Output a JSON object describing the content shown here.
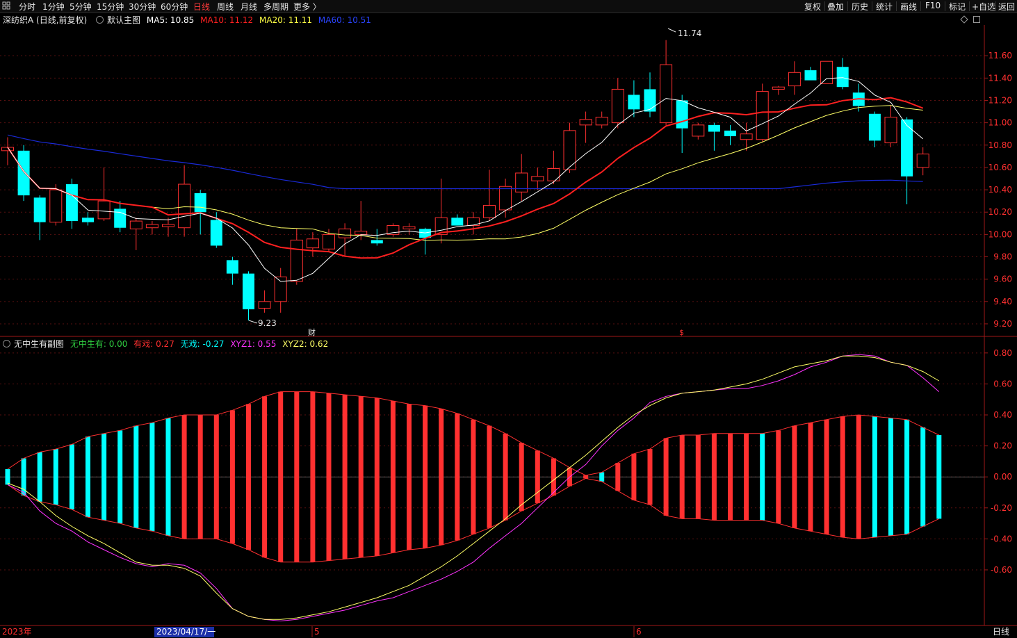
{
  "toolbar": {
    "left_icon": "grid-icon",
    "tabs": [
      "分时",
      "1分钟",
      "5分钟",
      "15分钟",
      "30分钟",
      "60分钟",
      "日线",
      "周线",
      "月线",
      "多周期",
      "更多 〉"
    ],
    "active_tab": "日线",
    "right_buttons": [
      "复权",
      "叠加",
      "历史",
      "统计",
      "画线",
      "F10",
      "标记",
      "+自选",
      "返回"
    ]
  },
  "main_info": {
    "stock": "深纺织A (日线,前复权)",
    "indicator": "默认主图",
    "ma5": "MA5: 10.85",
    "ma10": "MA10: 11.12",
    "ma20": "MA20: 11.11",
    "ma60": "MA60: 10.51"
  },
  "sub_info": {
    "indicator": "无中生有副图",
    "v1": "无中生有: 0.00",
    "v2": "有戏: 0.27",
    "v3": "无戏: -0.27",
    "v4": "XYZ1: 0.55",
    "v5": "XYZ2: 0.62"
  },
  "date_axis": {
    "start": "2023年",
    "cursor": "2023/04/17/一",
    "m5": "5",
    "m6": "6"
  },
  "period_label": "日线",
  "markers": {
    "high": "11.74",
    "low": "9.23",
    "cai": "财",
    "dollar": "$"
  },
  "colors": {
    "up": "#ff3030",
    "down": "#00ffff",
    "ma5": "#ffffff",
    "ma10": "#ff2020",
    "ma20": "#ffff66",
    "ma60": "#1a2ad8",
    "xyz1": "#ff33ff",
    "xyz2": "#ffff66"
  },
  "chart_data": [
    {
      "type": "candlestick",
      "title": "深纺织A (日线,前复权)",
      "ylim": [
        9.15,
        11.85
      ],
      "yticks": [
        9.2,
        9.4,
        9.6,
        9.8,
        10.0,
        10.2,
        10.4,
        10.6,
        10.8,
        11.0,
        11.2,
        11.4,
        11.6
      ],
      "candles": [
        {
          "o": 10.75,
          "h": 10.87,
          "l": 10.62,
          "c": 10.78
        },
        {
          "o": 10.75,
          "h": 10.8,
          "l": 10.3,
          "c": 10.35
        },
        {
          "o": 10.33,
          "h": 10.35,
          "l": 9.95,
          "c": 10.11
        },
        {
          "o": 10.11,
          "h": 10.45,
          "l": 10.08,
          "c": 10.4
        },
        {
          "o": 10.45,
          "h": 10.5,
          "l": 10.05,
          "c": 10.12
        },
        {
          "o": 10.15,
          "h": 10.2,
          "l": 10.08,
          "c": 10.11
        },
        {
          "o": 10.14,
          "h": 10.6,
          "l": 10.12,
          "c": 10.3
        },
        {
          "o": 10.23,
          "h": 10.3,
          "l": 10.02,
          "c": 10.06
        },
        {
          "o": 10.05,
          "h": 10.15,
          "l": 9.86,
          "c": 10.12
        },
        {
          "o": 10.06,
          "h": 10.12,
          "l": 10.0,
          "c": 10.09
        },
        {
          "o": 10.07,
          "h": 10.15,
          "l": 9.98,
          "c": 10.09
        },
        {
          "o": 10.06,
          "h": 10.62,
          "l": 9.98,
          "c": 10.45
        },
        {
          "o": 10.37,
          "h": 10.4,
          "l": 10.0,
          "c": 10.2
        },
        {
          "o": 10.13,
          "h": 10.2,
          "l": 9.88,
          "c": 9.9
        },
        {
          "o": 9.77,
          "h": 9.8,
          "l": 9.55,
          "c": 9.65
        },
        {
          "o": 9.65,
          "h": 9.67,
          "l": 9.23,
          "c": 9.33
        },
        {
          "o": 9.34,
          "h": 9.5,
          "l": 9.3,
          "c": 9.4
        },
        {
          "o": 9.4,
          "h": 9.7,
          "l": 9.3,
          "c": 9.62
        },
        {
          "o": 9.58,
          "h": 10.05,
          "l": 9.55,
          "c": 9.95
        },
        {
          "o": 9.88,
          "h": 10.02,
          "l": 9.8,
          "c": 9.96
        },
        {
          "o": 9.87,
          "h": 10.05,
          "l": 9.85,
          "c": 10.0
        },
        {
          "o": 9.97,
          "h": 10.1,
          "l": 9.8,
          "c": 10.05
        },
        {
          "o": 10.0,
          "h": 10.3,
          "l": 9.95,
          "c": 10.03
        },
        {
          "o": 9.95,
          "h": 10.05,
          "l": 9.9,
          "c": 9.92
        },
        {
          "o": 10.0,
          "h": 10.1,
          "l": 9.98,
          "c": 10.08
        },
        {
          "o": 10.05,
          "h": 10.1,
          "l": 10.0,
          "c": 10.07
        },
        {
          "o": 10.05,
          "h": 10.06,
          "l": 9.82,
          "c": 9.97
        },
        {
          "o": 10.0,
          "h": 10.5,
          "l": 9.92,
          "c": 10.15
        },
        {
          "o": 10.15,
          "h": 10.18,
          "l": 10.08,
          "c": 10.08
        },
        {
          "o": 10.08,
          "h": 10.2,
          "l": 10.0,
          "c": 10.15
        },
        {
          "o": 10.15,
          "h": 10.58,
          "l": 10.12,
          "c": 10.26
        },
        {
          "o": 10.22,
          "h": 10.5,
          "l": 10.15,
          "c": 10.43
        },
        {
          "o": 10.38,
          "h": 10.72,
          "l": 10.3,
          "c": 10.55
        },
        {
          "o": 10.48,
          "h": 10.6,
          "l": 10.4,
          "c": 10.52
        },
        {
          "o": 10.48,
          "h": 10.75,
          "l": 10.45,
          "c": 10.59
        },
        {
          "o": 10.58,
          "h": 11.0,
          "l": 10.55,
          "c": 10.93
        },
        {
          "o": 10.98,
          "h": 11.1,
          "l": 10.82,
          "c": 11.03
        },
        {
          "o": 10.98,
          "h": 11.1,
          "l": 10.95,
          "c": 11.05
        },
        {
          "o": 11.0,
          "h": 11.4,
          "l": 10.95,
          "c": 11.3
        },
        {
          "o": 11.25,
          "h": 11.38,
          "l": 11.05,
          "c": 11.12
        },
        {
          "o": 11.3,
          "h": 11.45,
          "l": 11.05,
          "c": 11.1
        },
        {
          "o": 11.0,
          "h": 11.74,
          "l": 10.98,
          "c": 11.52
        },
        {
          "o": 11.2,
          "h": 11.25,
          "l": 10.73,
          "c": 10.95
        },
        {
          "o": 10.88,
          "h": 11.0,
          "l": 10.85,
          "c": 10.98
        },
        {
          "o": 10.98,
          "h": 11.0,
          "l": 10.75,
          "c": 10.92
        },
        {
          "o": 10.93,
          "h": 10.98,
          "l": 10.8,
          "c": 10.88
        },
        {
          "o": 10.85,
          "h": 11.0,
          "l": 10.75,
          "c": 10.9
        },
        {
          "o": 10.85,
          "h": 11.35,
          "l": 10.83,
          "c": 11.28
        },
        {
          "o": 11.3,
          "h": 11.33,
          "l": 11.25,
          "c": 11.32
        },
        {
          "o": 11.33,
          "h": 11.55,
          "l": 11.25,
          "c": 11.45
        },
        {
          "o": 11.47,
          "h": 11.5,
          "l": 11.38,
          "c": 11.38
        },
        {
          "o": 11.35,
          "h": 11.55,
          "l": 11.35,
          "c": 11.55
        },
        {
          "o": 11.5,
          "h": 11.58,
          "l": 11.3,
          "c": 11.32
        },
        {
          "o": 11.27,
          "h": 11.35,
          "l": 11.1,
          "c": 11.15
        },
        {
          "o": 11.08,
          "h": 11.1,
          "l": 10.78,
          "c": 10.84
        },
        {
          "o": 10.82,
          "h": 11.15,
          "l": 10.78,
          "c": 11.05
        },
        {
          "o": 11.03,
          "h": 11.05,
          "l": 10.27,
          "c": 10.52
        },
        {
          "o": 10.6,
          "h": 10.78,
          "l": 10.53,
          "c": 10.72
        }
      ]
    },
    {
      "type": "bar",
      "title": "无中生有副图",
      "ylim": [
        -0.95,
        0.88
      ],
      "yticks": [
        -0.6,
        -0.4,
        -0.2,
        0.0,
        0.2,
        0.4,
        0.6,
        0.8
      ],
      "series": [
        {
          "name": "有戏",
          "values": [
            0.05,
            0.12,
            0.16,
            0.18,
            0.21,
            0.26,
            0.28,
            0.3,
            0.33,
            0.35,
            0.38,
            0.4,
            0.4,
            0.4,
            0.43,
            0.47,
            0.52,
            0.55,
            0.55,
            0.55,
            0.54,
            0.53,
            0.52,
            0.51,
            0.49,
            0.47,
            0.46,
            0.44,
            0.41,
            0.37,
            0.33,
            0.28,
            0.22,
            0.17,
            0.12,
            0.06,
            0.01,
            0.03,
            0.09,
            0.15,
            0.18,
            0.25,
            0.27,
            0.27,
            0.28,
            0.28,
            0.28,
            0.28,
            0.3,
            0.33,
            0.35,
            0.37,
            0.39,
            0.4,
            0.39,
            0.38,
            0.37,
            0.32,
            0.27
          ]
        },
        {
          "name": "无戏",
          "values": [
            -0.05,
            -0.12,
            -0.16,
            -0.18,
            -0.21,
            -0.26,
            -0.28,
            -0.3,
            -0.33,
            -0.35,
            -0.38,
            -0.4,
            -0.4,
            -0.4,
            -0.43,
            -0.47,
            -0.52,
            -0.55,
            -0.55,
            -0.55,
            -0.54,
            -0.53,
            -0.52,
            -0.51,
            -0.49,
            -0.47,
            -0.46,
            -0.44,
            -0.41,
            -0.37,
            -0.33,
            -0.28,
            -0.22,
            -0.17,
            -0.12,
            -0.06,
            -0.01,
            -0.03,
            -0.09,
            -0.15,
            -0.18,
            -0.25,
            -0.27,
            -0.27,
            -0.28,
            -0.28,
            -0.28,
            -0.28,
            -0.3,
            -0.33,
            -0.35,
            -0.37,
            -0.39,
            -0.4,
            -0.39,
            -0.38,
            -0.37,
            -0.32,
            -0.27
          ]
        },
        {
          "name": "XYZ1",
          "values": [
            -0.05,
            -0.1,
            -0.22,
            -0.3,
            -0.35,
            -0.42,
            -0.47,
            -0.52,
            -0.56,
            -0.58,
            -0.56,
            -0.57,
            -0.62,
            -0.72,
            -0.85,
            -0.9,
            -0.92,
            -0.93,
            -0.92,
            -0.9,
            -0.88,
            -0.86,
            -0.83,
            -0.8,
            -0.78,
            -0.74,
            -0.7,
            -0.66,
            -0.61,
            -0.55,
            -0.46,
            -0.38,
            -0.3,
            -0.2,
            -0.1,
            0.0,
            0.08,
            0.2,
            0.3,
            0.38,
            0.48,
            0.52,
            0.54,
            0.55,
            0.56,
            0.57,
            0.57,
            0.59,
            0.62,
            0.66,
            0.71,
            0.74,
            0.78,
            0.79,
            0.78,
            0.74,
            0.72,
            0.64,
            0.55
          ]
        },
        {
          "name": "XYZ2",
          "values": [
            -0.04,
            -0.08,
            -0.16,
            -0.25,
            -0.32,
            -0.38,
            -0.43,
            -0.49,
            -0.55,
            -0.57,
            -0.57,
            -0.59,
            -0.64,
            -0.75,
            -0.85,
            -0.9,
            -0.92,
            -0.92,
            -0.91,
            -0.89,
            -0.87,
            -0.84,
            -0.81,
            -0.78,
            -0.74,
            -0.7,
            -0.64,
            -0.58,
            -0.51,
            -0.43,
            -0.35,
            -0.27,
            -0.18,
            -0.1,
            -0.02,
            0.06,
            0.14,
            0.23,
            0.32,
            0.4,
            0.46,
            0.51,
            0.54,
            0.55,
            0.56,
            0.58,
            0.6,
            0.63,
            0.67,
            0.71,
            0.73,
            0.75,
            0.78,
            0.78,
            0.77,
            0.74,
            0.72,
            0.68,
            0.62
          ]
        }
      ]
    }
  ]
}
